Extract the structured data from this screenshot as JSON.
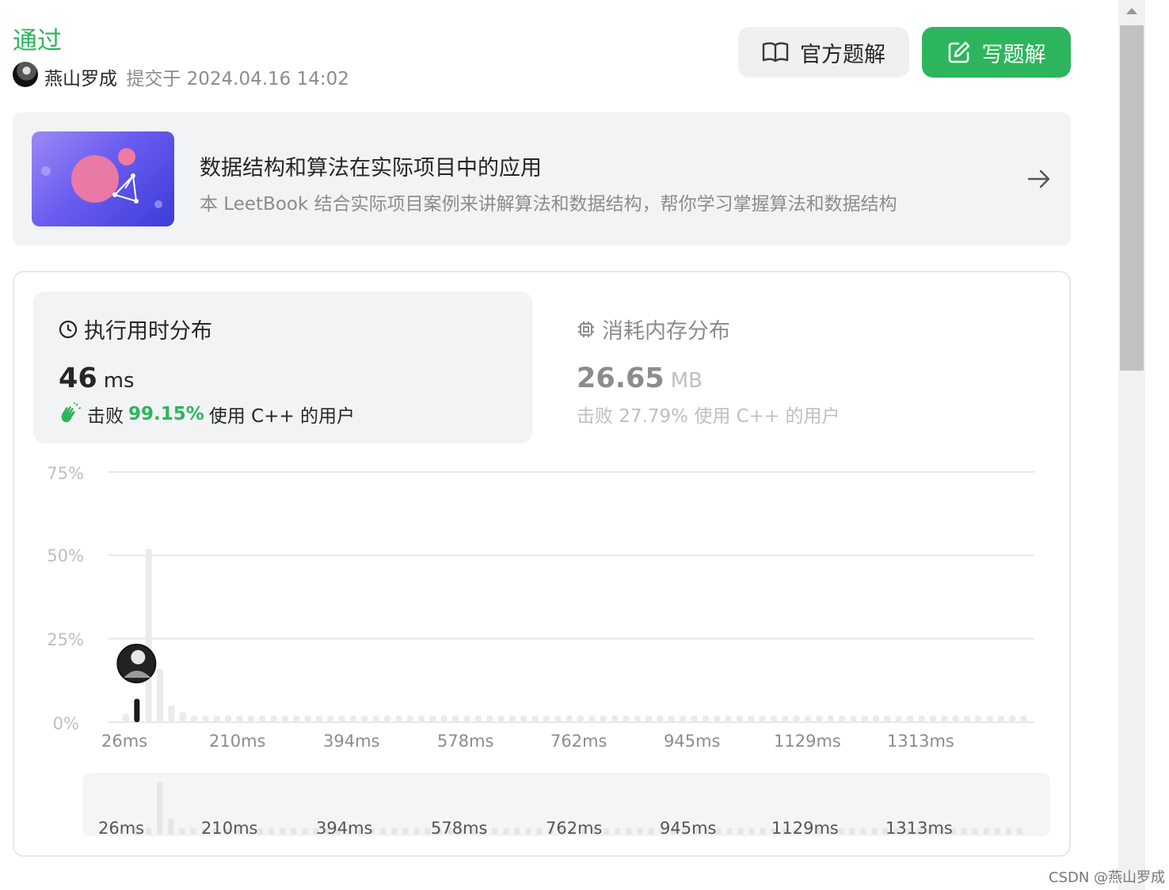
{
  "header": {
    "status": "通过",
    "username": "燕山罗成",
    "submitted": "提交于 2024.04.16 14:02",
    "official_solution": "官方题解",
    "write_solution": "写题解"
  },
  "leetbook": {
    "title": "数据结构和算法在实际项目中的应用",
    "description": "本 LeetBook 结合实际项目案例来讲解算法和数据结构，帮你学习掌握算法和数据结构"
  },
  "runtime": {
    "label": "执行用时分布",
    "value": "46",
    "unit": "ms",
    "beat_prefix": "击败",
    "beat_pct": "99.15%",
    "beat_suffix": "使用 C++ 的用户"
  },
  "memory": {
    "label": "消耗内存分布",
    "value": "26.65",
    "unit": "MB",
    "beat_text": "击败 27.79% 使用 C++ 的用户"
  },
  "chart_data": {
    "type": "bar",
    "ylim": [
      0,
      75
    ],
    "y_ticks": [
      "75%",
      "50%",
      "25%",
      "0%"
    ],
    "x_ticks": [
      "26ms",
      "210ms",
      "394ms",
      "578ms",
      "762ms",
      "945ms",
      "1129ms",
      "1313ms"
    ],
    "bar_start_ms": 26,
    "bar_step_ms": 18.4,
    "values": [
      2.5,
      7,
      52,
      16,
      5,
      3,
      2,
      2,
      2,
      2,
      2,
      2,
      2,
      2,
      2,
      2,
      2,
      2,
      2,
      2,
      2,
      2,
      2,
      2,
      2,
      2,
      2,
      2,
      2,
      2,
      2,
      2,
      2,
      2,
      2,
      2,
      2,
      2,
      2,
      2,
      2,
      2,
      2,
      2,
      2,
      2,
      2,
      2,
      2,
      2,
      2,
      2,
      2,
      2,
      2,
      2,
      2,
      2,
      2,
      2,
      2,
      2,
      2,
      2,
      2,
      2,
      2,
      2,
      2,
      2,
      2,
      2,
      2,
      2,
      2,
      2,
      2,
      2,
      2,
      2
    ],
    "highlight_index": 1,
    "colors": {
      "bar": "#ebebeb",
      "highlight": "#1a1a1a",
      "grid": "#e8e8e8"
    }
  },
  "footer": {
    "watermark": "CSDN @燕山罗成"
  }
}
